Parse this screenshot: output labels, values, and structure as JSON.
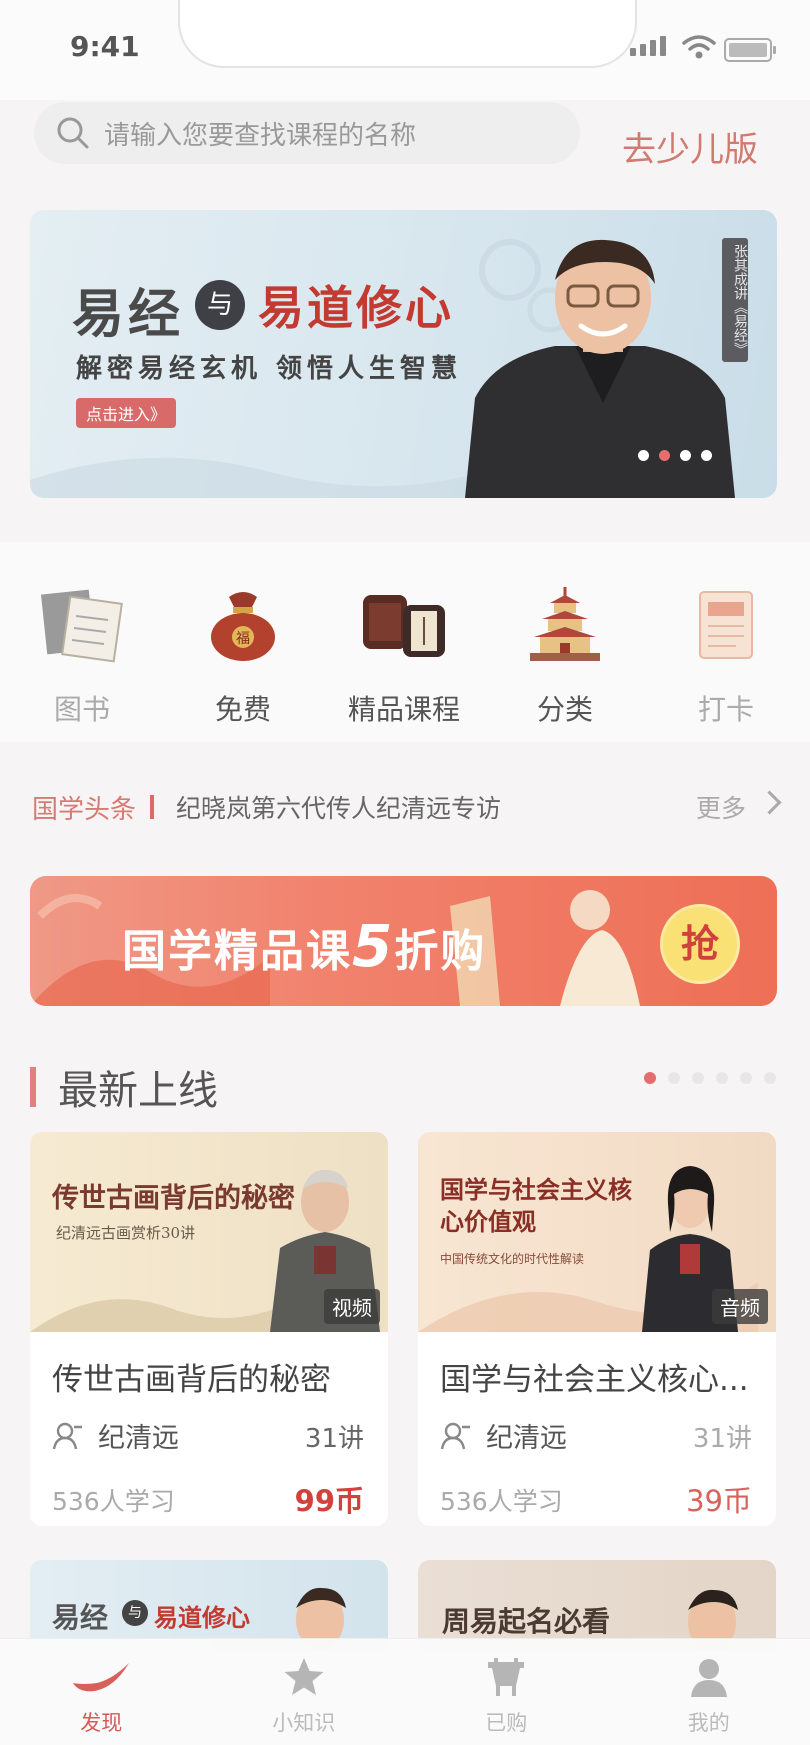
{
  "status": {
    "time": "9:41"
  },
  "search": {
    "placeholder": "请输入您要查找课程的名称",
    "kids_link": "去少儿版"
  },
  "banner": {
    "title_left": "易经",
    "title_mid": "与",
    "title_right": "易道修心",
    "subtitle": "解密易经玄机 领悟人生智慧",
    "button": "点击进入》",
    "side_caption": "张其成讲《易经》",
    "dots": 4,
    "active_dot": 2
  },
  "categories": [
    {
      "label": "图书",
      "icon": "books-icon"
    },
    {
      "label": "免费",
      "icon": "lucky-bag-icon"
    },
    {
      "label": "精品课程",
      "icon": "scroll-icon"
    },
    {
      "label": "分类",
      "icon": "pagoda-icon"
    },
    {
      "label": "打卡",
      "icon": "checkin-card-icon"
    }
  ],
  "news": {
    "tag": "国学头条",
    "headline": "纪晓岚第六代传人纪清远专访",
    "more": "更多"
  },
  "promo": {
    "text_pre": "国学精品课",
    "text_num": "5",
    "text_post": "折购",
    "badge": "抢"
  },
  "section": {
    "title": "最新上线",
    "dots": 6,
    "active_dot": 1
  },
  "courses": [
    {
      "image_title": "传世古画背后的秘密",
      "image_subtitle": "纪清远古画赏析30讲",
      "media": "视频",
      "title": "传世古画背后的秘密",
      "author": "纪清远",
      "lectures": "31讲",
      "learners": "536人学习",
      "price": "99币"
    },
    {
      "image_title": "国学与社会主义核心价值观",
      "image_subtitle": "中国传统文化的时代性解读",
      "media": "音频",
      "title": "国学与社会主义核心...",
      "author": "纪清远",
      "lectures": "31讲",
      "learners": "536人学习",
      "price": "39币"
    }
  ],
  "peek": [
    {
      "left": "易经",
      "mid": "与",
      "right": "易道修心"
    },
    {
      "title": "周易起名必看"
    }
  ],
  "tabs": [
    {
      "label": "发现",
      "active": true
    },
    {
      "label": "小知识",
      "active": false
    },
    {
      "label": "已购",
      "active": false
    },
    {
      "label": "我的",
      "active": false
    }
  ]
}
